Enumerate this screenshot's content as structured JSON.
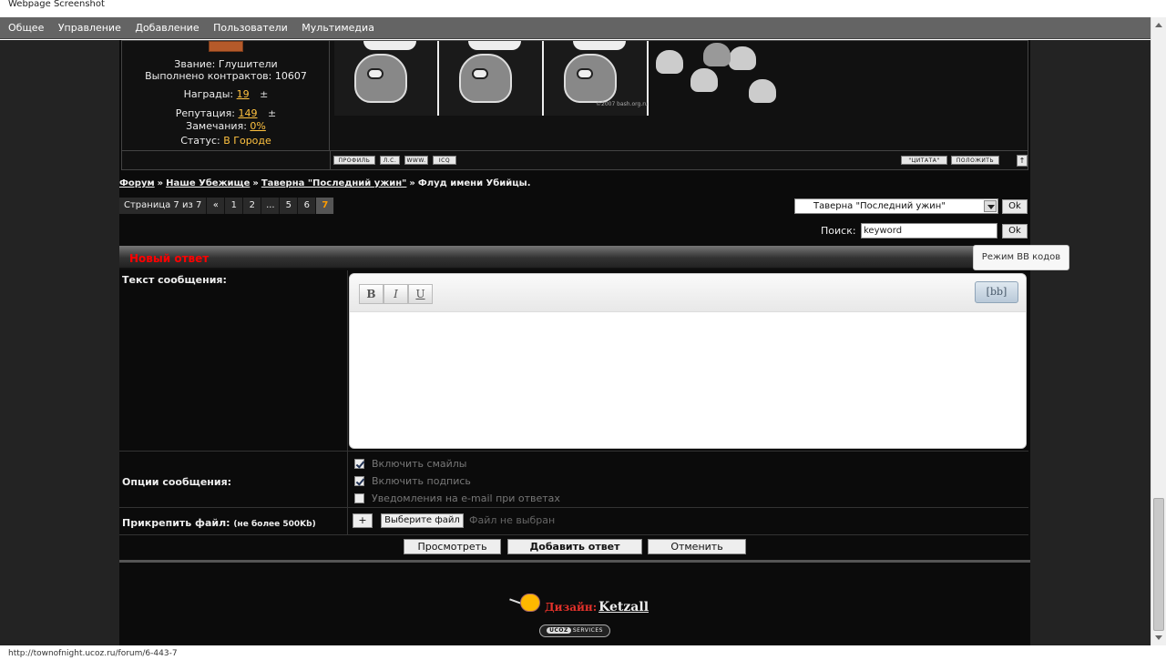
{
  "window": {
    "title": "Webpage Screenshot"
  },
  "menu": [
    "Общее",
    "Управление",
    "Добавление",
    "Пользователи",
    "Мультимедиа"
  ],
  "user": {
    "rank": "Звание: Глушители",
    "contracts": "Выполнено контрактов: 10607",
    "awards_label": "Награды:",
    "awards_value": "19",
    "rep_label": "Репутация:",
    "rep_value": "149",
    "warn_label": "Замечания:",
    "warn_value": "0%",
    "status_label": "Статус:",
    "status_value": "В Городе",
    "plusminus": "±"
  },
  "signature": {
    "caption": "©2007 bash.org.ru"
  },
  "post_buttons": {
    "profile": "ПРОФИЛЬ",
    "pm": "Л.С.",
    "www": "WWW.",
    "icq": "ICQ",
    "quote": "\"ЦИТАТА\"",
    "pick": "ПОЛОЖИТЬ",
    "up": "↑"
  },
  "breadcrumbs": [
    "Форум",
    "Наше Убежище",
    "Таверна \"Последний ужин\"",
    "Флуд имени Убийцы."
  ],
  "breadcrumb_sep": "»",
  "pager": {
    "label": "Страница 7 из 7",
    "items": [
      "«",
      "1",
      "2",
      "...",
      "5",
      "6",
      "7"
    ],
    "current": "7"
  },
  "forum_select": {
    "value": "Таверна \"Последний ужин\"",
    "ok": "Ok"
  },
  "search": {
    "label": "Поиск:",
    "value": "keyword",
    "ok": "Ok"
  },
  "reply": {
    "title": "Новый ответ",
    "text_label": "Текст сообщения:",
    "tooltip": "Режим BB кодов",
    "bold": "B",
    "italic": "I",
    "underline": "U",
    "bb": "[bb]",
    "options_label": "Опции сообщения:",
    "options": [
      {
        "label": "Включить смайлы",
        "checked": true
      },
      {
        "label": "Включить подпись",
        "checked": true
      },
      {
        "label": "Уведомления на e-mail при ответах",
        "checked": false
      }
    ],
    "attach_label": "Прикрепить файл:",
    "attach_hint": "(не более 500Kb)",
    "attach_plus": "+",
    "choose_file": "Выберите файл",
    "no_file": "Файл не выбран",
    "preview": "Просмотреть",
    "submit": "Добавить ответ",
    "cancel": "Отменить"
  },
  "footer": {
    "design_label": "Дизайн:",
    "designer": "Ketzall",
    "ucoz_a": "UCOZ",
    "ucoz_b": "SERVICES"
  },
  "status_url": "http://townofnight.ucoz.ru/forum/6-443-7",
  "colors": {
    "accent_yellow": "#ffc240",
    "title_red": "#ff0000",
    "page_current": "#ff9d00",
    "design_red": "#e4322b"
  }
}
